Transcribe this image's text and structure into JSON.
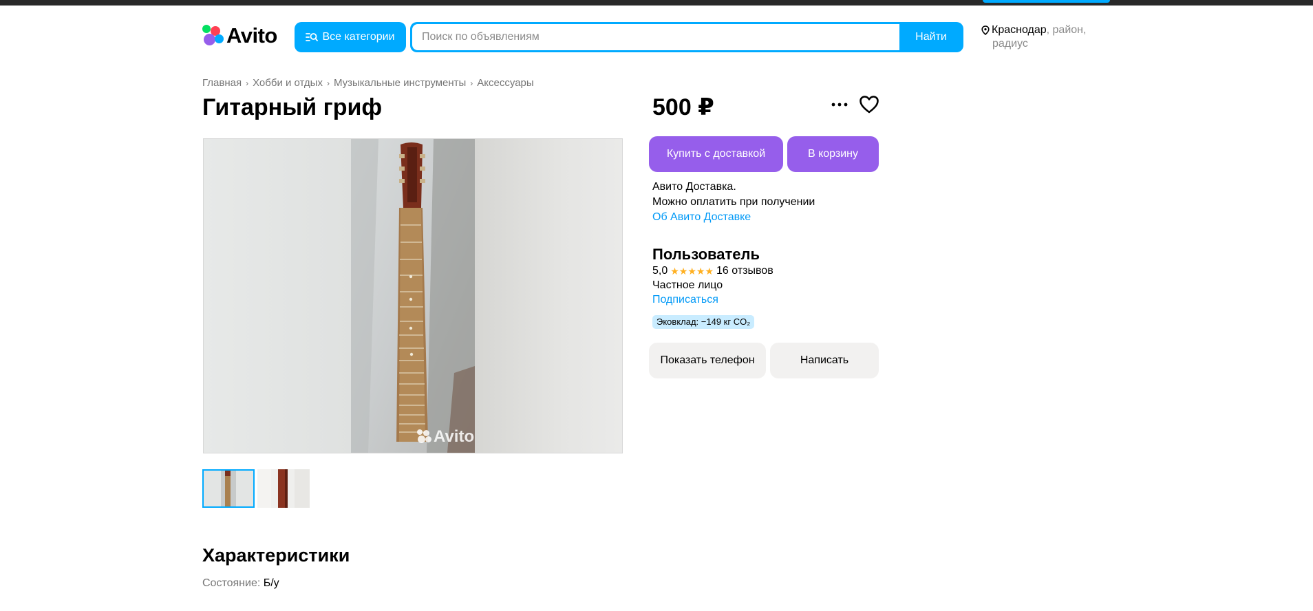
{
  "header": {
    "logo_text": "Avito",
    "categories_label": "Все категории",
    "search_placeholder": "Поиск по объявлениям",
    "search_button": "Найти",
    "location_city": "Краснодар",
    "location_district": "район",
    "location_radius": "радиус"
  },
  "breadcrumbs": [
    "Главная",
    "Хобби и отдых",
    "Музыкальные инструменты",
    "Аксессуары"
  ],
  "listing": {
    "title": "Гитарный гриф",
    "price": "500 ₽",
    "watermark": "Avito",
    "thumbnails_count": 2
  },
  "actions": {
    "buy_delivery": "Купить с доставкой",
    "add_to_cart": "В корзину",
    "show_phone": "Показать телефон",
    "write": "Написать"
  },
  "delivery": {
    "line1": "Авито Доставка.",
    "line2": "Можно оплатить при получении",
    "link": "Об Авито Доставке"
  },
  "seller": {
    "name": "Пользователь",
    "rating": "5,0",
    "stars": "★★★★★",
    "reviews": "16 отзывов",
    "type": "Частное лицо",
    "subscribe": "Подписаться",
    "eco": "Эковклад: −149 кг CO₂"
  },
  "characteristics": {
    "title": "Характеристики",
    "items": [
      {
        "key": "Состояние:",
        "value": "Б/у"
      }
    ]
  },
  "colors": {
    "brand_blue": "#00aaff",
    "purple": "#965eeb",
    "link": "#0099f7",
    "star": "#ffb021"
  }
}
